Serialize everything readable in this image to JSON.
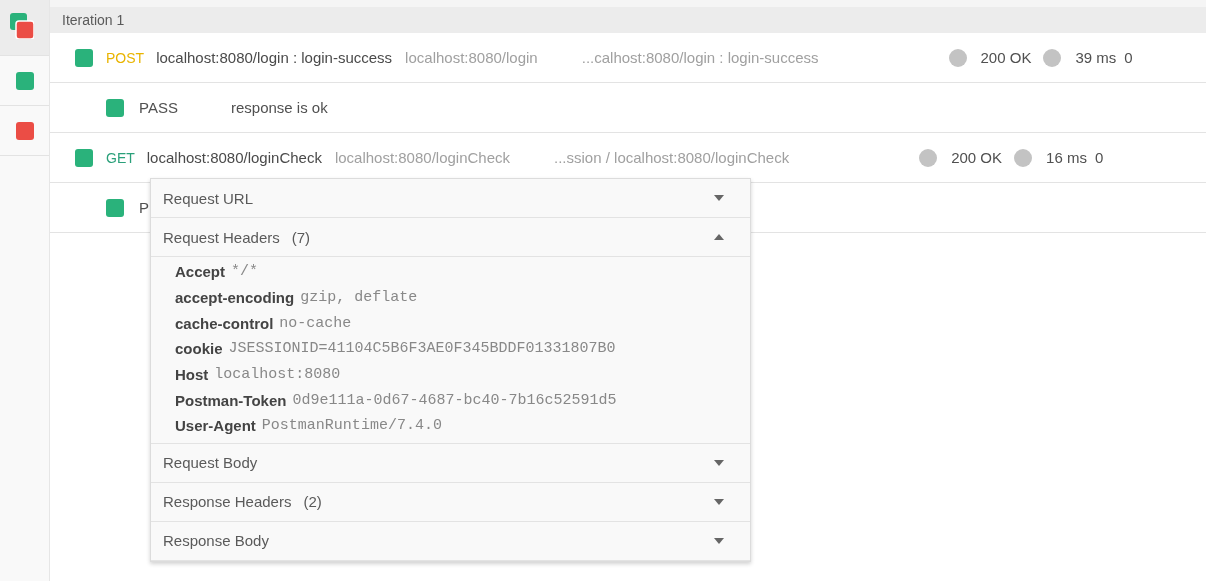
{
  "sidebar": {
    "items": [
      {
        "kind": "mixed",
        "selected": true
      },
      {
        "kind": "pass",
        "selected": false
      },
      {
        "kind": "fail",
        "selected": false
      }
    ]
  },
  "iteration": {
    "title": "Iteration 1"
  },
  "rows": [
    {
      "kind": "request",
      "passed": true,
      "method": "POST",
      "name": "localhost:8080/login : login-success",
      "url": "localhost:8080/login",
      "path": "...calhost:8080/login : login-success",
      "code": "200 OK",
      "time": "39 ms",
      "size": "0"
    },
    {
      "kind": "test",
      "passed": true,
      "result": "PASS",
      "message": "response is ok"
    },
    {
      "kind": "request",
      "passed": true,
      "method": "GET",
      "name": "localhost:8080/loginCheck",
      "url": "localhost:8080/loginCheck",
      "path": "...ssion / localhost:8080/loginCheck",
      "code": "200 OK",
      "time": "16 ms",
      "size": "0"
    },
    {
      "kind": "test",
      "passed": true,
      "result": "P"
    }
  ],
  "popover": {
    "sections": [
      {
        "title": "Request URL",
        "expanded": false
      },
      {
        "title": "Request Headers",
        "count": "(7)",
        "expanded": true,
        "headers": [
          {
            "key": "Accept",
            "value": "*/*"
          },
          {
            "key": "accept-encoding",
            "value": "gzip, deflate"
          },
          {
            "key": "cache-control",
            "value": "no-cache"
          },
          {
            "key": "cookie",
            "value": "JSESSIONID=41104C5B6F3AE0F345BDDF01331807B0"
          },
          {
            "key": "Host",
            "value": "localhost:8080"
          },
          {
            "key": "Postman-Token",
            "value": "0d9e111a-0d67-4687-bc40-7b16c52591d5"
          },
          {
            "key": "User-Agent",
            "value": "PostmanRuntime/7.4.0"
          }
        ]
      },
      {
        "title": "Request Body",
        "expanded": false
      },
      {
        "title": "Response Headers",
        "count": "(2)",
        "expanded": false
      },
      {
        "title": "Response Body",
        "expanded": false
      }
    ]
  }
}
